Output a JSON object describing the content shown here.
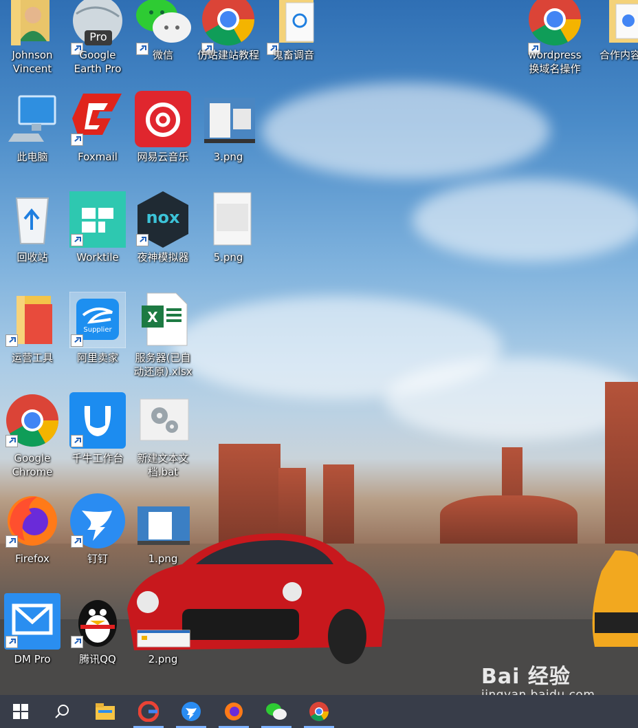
{
  "desktop": {
    "icons": [
      {
        "label": "Johnson\nVincent"
      },
      {
        "label": "Google\nEarth Pro",
        "badge": "Pro"
      },
      {
        "label": "微信"
      },
      {
        "label": "仿站建站教程"
      },
      {
        "label": "鬼畜调音"
      },
      {
        "label": "wordpress\n换域名操作"
      },
      {
        "label": "合作内容"
      },
      {
        "label": "此电脑"
      },
      {
        "label": "Foxmail"
      },
      {
        "label": "网易云音乐"
      },
      {
        "label": "3.png"
      },
      {
        "label": "回收站"
      },
      {
        "label": "Worktile"
      },
      {
        "label": "夜神模拟器",
        "badge": "nox"
      },
      {
        "label": "5.png"
      },
      {
        "label": "运营工具"
      },
      {
        "label": "阿里卖家",
        "badge": "Supplier"
      },
      {
        "label": "服务器(已自\n动还原).xlsx"
      },
      {
        "label": "Google\nChrome"
      },
      {
        "label": "千牛工作台"
      },
      {
        "label": "新建文本文\n档.bat"
      },
      {
        "label": "Firefox"
      },
      {
        "label": "钉钉"
      },
      {
        "label": "1.png"
      },
      {
        "label": "DM Pro"
      },
      {
        "label": "腾讯QQ"
      },
      {
        "label": "2.png"
      }
    ]
  },
  "taskbar": {
    "items": [
      {
        "name": "start"
      },
      {
        "name": "search"
      },
      {
        "name": "file-explorer"
      },
      {
        "name": "google-chrome",
        "active": true
      },
      {
        "name": "dingtalk",
        "active": true
      },
      {
        "name": "firefox",
        "active": true
      },
      {
        "name": "wechat",
        "active": true
      },
      {
        "name": "chrome-2",
        "active": true
      }
    ]
  },
  "watermark": {
    "brand": "Bai 经验",
    "url": "jingyan.baidu.com"
  },
  "colors": {
    "taskbar": "#303542",
    "accent": "#7fb3ff",
    "label_text": "#ffffff"
  }
}
